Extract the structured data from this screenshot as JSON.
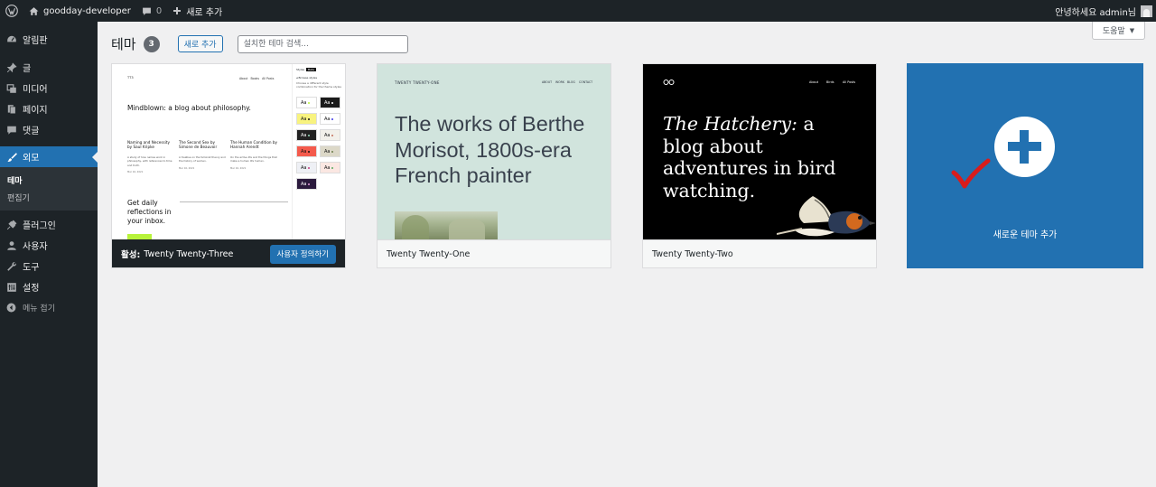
{
  "admin_bar": {
    "site_name": "goodday-developer",
    "comments_count": "0",
    "new_label": "새로 추가",
    "greeting": "안녕하세요 admin님"
  },
  "sidebar": {
    "items": [
      {
        "label": "알림판",
        "icon": "dashboard-icon"
      },
      {
        "label": "글",
        "icon": "pin-icon"
      },
      {
        "label": "미디어",
        "icon": "media-icon"
      },
      {
        "label": "페이지",
        "icon": "page-icon"
      },
      {
        "label": "댓글",
        "icon": "comment-icon"
      },
      {
        "label": "외모",
        "icon": "brush-icon"
      },
      {
        "label": "플러그인",
        "icon": "plugin-icon"
      },
      {
        "label": "사용자",
        "icon": "user-icon"
      },
      {
        "label": "도구",
        "icon": "wrench-icon"
      },
      {
        "label": "설정",
        "icon": "settings-icon"
      }
    ],
    "submenu": [
      "테마",
      "편집기"
    ],
    "collapse_label": "메뉴 접기"
  },
  "header": {
    "title": "테마",
    "count": "3",
    "add_new": "새로 추가",
    "search_placeholder": "설치한 테마 검색...",
    "help": "도움말"
  },
  "themes": {
    "active": {
      "active_prefix": "활성:",
      "name": "Twenty Twenty-Three",
      "customize": "사용자 정의하기",
      "preview": {
        "headline": "Mindblown: a blog about philosophy.",
        "col1": "Naming and Necessity by Saul Kripke",
        "col2": "The Second Sex by Simone de Beauvoir",
        "col3": "The Human Condition by Hannah Arendt",
        "subscribe": "Get daily reflections in your inbox."
      }
    },
    "tt1": {
      "name": "Twenty Twenty-One",
      "preview_site": "TWENTY TWENTY-ONE",
      "preview_nav": [
        "ABOUT",
        "WORK",
        "BLOG",
        "CONTACT"
      ],
      "preview_text": "The works of Berthe Morisot, 1800s-era French painter"
    },
    "tt2": {
      "name": "Twenty Twenty-Two",
      "preview_nav": [
        "About",
        "Birds",
        "All Posts"
      ],
      "preview_italic": "The Hatchery:",
      "preview_text": " a blog about adventures in bird watching."
    }
  },
  "add_theme": {
    "label": "새로운 테마 추가"
  },
  "colors": {
    "accent": "#2271b1",
    "admin_dark": "#1d2327",
    "check_red": "#d91c1c"
  }
}
